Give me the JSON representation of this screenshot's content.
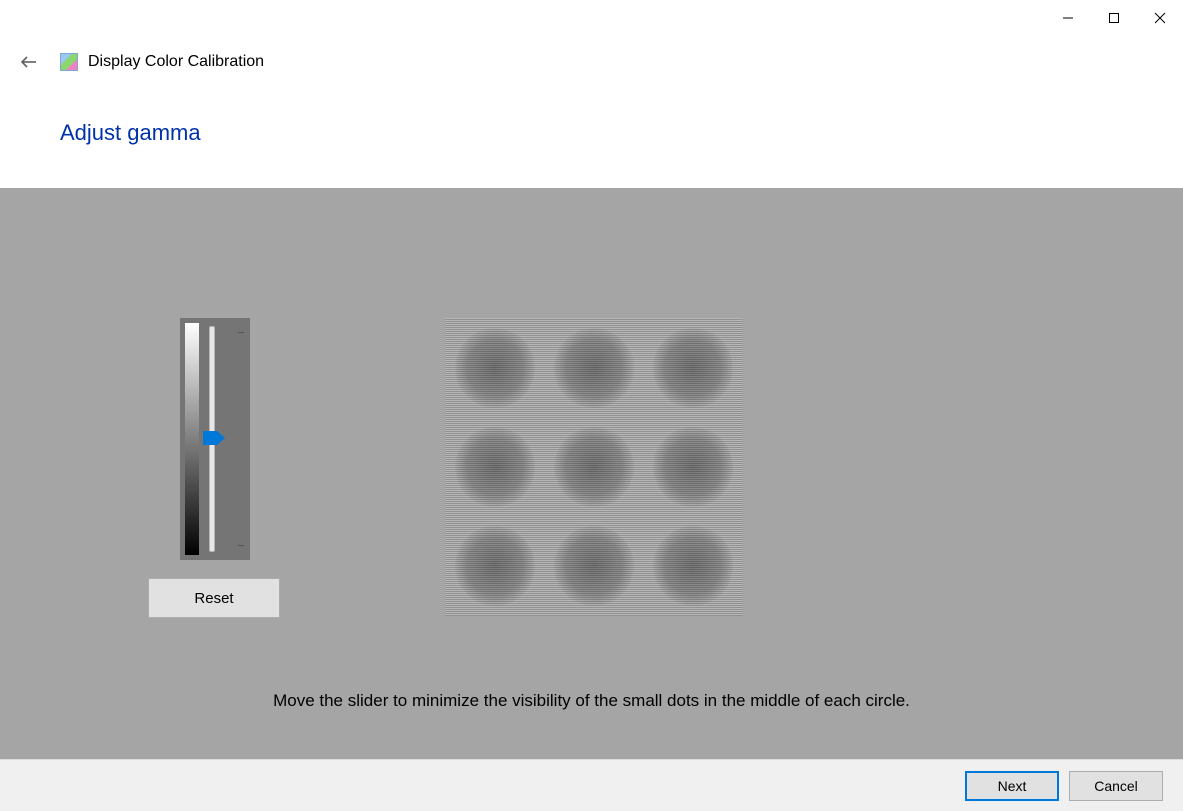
{
  "window": {
    "title": "Display Color Calibration"
  },
  "page": {
    "heading": "Adjust gamma",
    "instruction": "Move the slider to minimize the visibility of the small dots in the middle of each circle."
  },
  "controls": {
    "reset_label": "Reset"
  },
  "footer": {
    "next_label": "Next",
    "cancel_label": "Cancel"
  }
}
